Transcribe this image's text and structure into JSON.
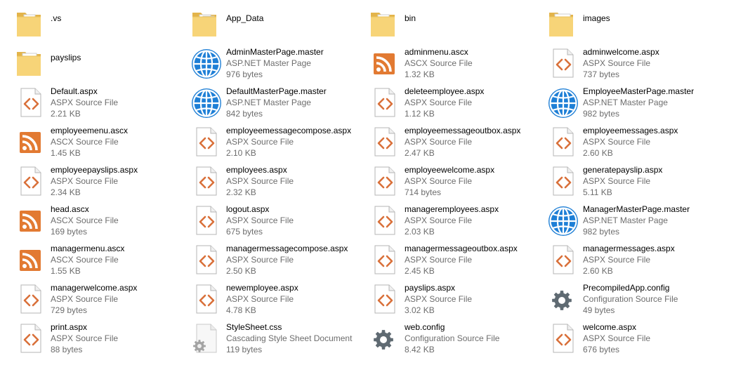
{
  "explorer": {
    "items": [
      {
        "name": ".vs",
        "icon": "folder-icon",
        "folder_art": "doc"
      },
      {
        "name": "App_Data",
        "icon": "folder-icon",
        "folder_art": "plain"
      },
      {
        "name": "bin",
        "icon": "folder-icon",
        "folder_art": "gear"
      },
      {
        "name": "images",
        "icon": "folder-icon",
        "folder_art": "image"
      },
      {
        "name": "payslips",
        "icon": "folder-icon",
        "folder_art": "pdf"
      },
      {
        "name": "AdminMasterPage.master",
        "type": "ASP.NET Master Page",
        "size": "976 bytes",
        "icon": "globe-icon"
      },
      {
        "name": "adminmenu.ascx",
        "type": "ASCX Source File",
        "size": "1.32 KB",
        "icon": "rss-icon"
      },
      {
        "name": "adminwelcome.aspx",
        "type": "ASPX Source File",
        "size": "737 bytes",
        "icon": "code-file-icon"
      },
      {
        "name": "Default.aspx",
        "type": "ASPX Source File",
        "size": "2.21 KB",
        "icon": "code-file-icon"
      },
      {
        "name": "DefaultMasterPage.master",
        "type": "ASP.NET Master Page",
        "size": "842 bytes",
        "icon": "globe-icon"
      },
      {
        "name": "deleteemployee.aspx",
        "type": "ASPX Source File",
        "size": "1.12 KB",
        "icon": "code-file-icon"
      },
      {
        "name": "EmployeeMasterPage.master",
        "type": "ASP.NET Master Page",
        "size": "982 bytes",
        "icon": "globe-icon"
      },
      {
        "name": "employeemenu.ascx",
        "type": "ASCX Source File",
        "size": "1.45 KB",
        "icon": "rss-icon"
      },
      {
        "name": "employeemessagecompose.aspx",
        "type": "ASPX Source File",
        "size": "2.10 KB",
        "icon": "code-file-icon"
      },
      {
        "name": "employeemessageoutbox.aspx",
        "type": "ASPX Source File",
        "size": "2.47 KB",
        "icon": "code-file-icon"
      },
      {
        "name": "employeemessages.aspx",
        "type": "ASPX Source File",
        "size": "2.60 KB",
        "icon": "code-file-icon"
      },
      {
        "name": "employeepayslips.aspx",
        "type": "ASPX Source File",
        "size": "2.34 KB",
        "icon": "code-file-icon"
      },
      {
        "name": "employees.aspx",
        "type": "ASPX Source File",
        "size": "2.32 KB",
        "icon": "code-file-icon"
      },
      {
        "name": "employeewelcome.aspx",
        "type": "ASPX Source File",
        "size": "714 bytes",
        "icon": "code-file-icon"
      },
      {
        "name": "generatepayslip.aspx",
        "type": "ASPX Source File",
        "size": "5.11 KB",
        "icon": "code-file-icon"
      },
      {
        "name": "head.ascx",
        "type": "ASCX Source File",
        "size": "169 bytes",
        "icon": "rss-icon"
      },
      {
        "name": "logout.aspx",
        "type": "ASPX Source File",
        "size": "675 bytes",
        "icon": "code-file-icon"
      },
      {
        "name": "manageremployees.aspx",
        "type": "ASPX Source File",
        "size": "2.03 KB",
        "icon": "code-file-icon"
      },
      {
        "name": "ManagerMasterPage.master",
        "type": "ASP.NET Master Page",
        "size": "982 bytes",
        "icon": "globe-icon"
      },
      {
        "name": "managermenu.ascx",
        "type": "ASCX Source File",
        "size": "1.55 KB",
        "icon": "rss-icon"
      },
      {
        "name": "managermessagecompose.aspx",
        "type": "ASPX Source File",
        "size": "2.50 KB",
        "icon": "code-file-icon"
      },
      {
        "name": "managermessageoutbox.aspx",
        "type": "ASPX Source File",
        "size": "2.45 KB",
        "icon": "code-file-icon"
      },
      {
        "name": "managermessages.aspx",
        "type": "ASPX Source File",
        "size": "2.60 KB",
        "icon": "code-file-icon"
      },
      {
        "name": "managerwelcome.aspx",
        "type": "ASPX Source File",
        "size": "729 bytes",
        "icon": "code-file-icon"
      },
      {
        "name": "newemployee.aspx",
        "type": "ASPX Source File",
        "size": "4.78 KB",
        "icon": "code-file-icon"
      },
      {
        "name": "payslips.aspx",
        "type": "ASPX Source File",
        "size": "3.02 KB",
        "icon": "code-file-icon"
      },
      {
        "name": "PrecompiledApp.config",
        "type": "Configuration Source File",
        "size": "49 bytes",
        "icon": "config-gear-icon"
      },
      {
        "name": "print.aspx",
        "type": "ASPX Source File",
        "size": "88 bytes",
        "icon": "code-file-icon"
      },
      {
        "name": "StyleSheet.css",
        "type": "Cascading Style Sheet Document",
        "size": "119 bytes",
        "icon": "css-file-icon"
      },
      {
        "name": "web.config",
        "type": "Configuration Source File",
        "size": "8.42 KB",
        "icon": "config-gear-icon"
      },
      {
        "name": "welcome.aspx",
        "type": "ASPX Source File",
        "size": "676 bytes",
        "icon": "code-file-icon"
      }
    ]
  }
}
